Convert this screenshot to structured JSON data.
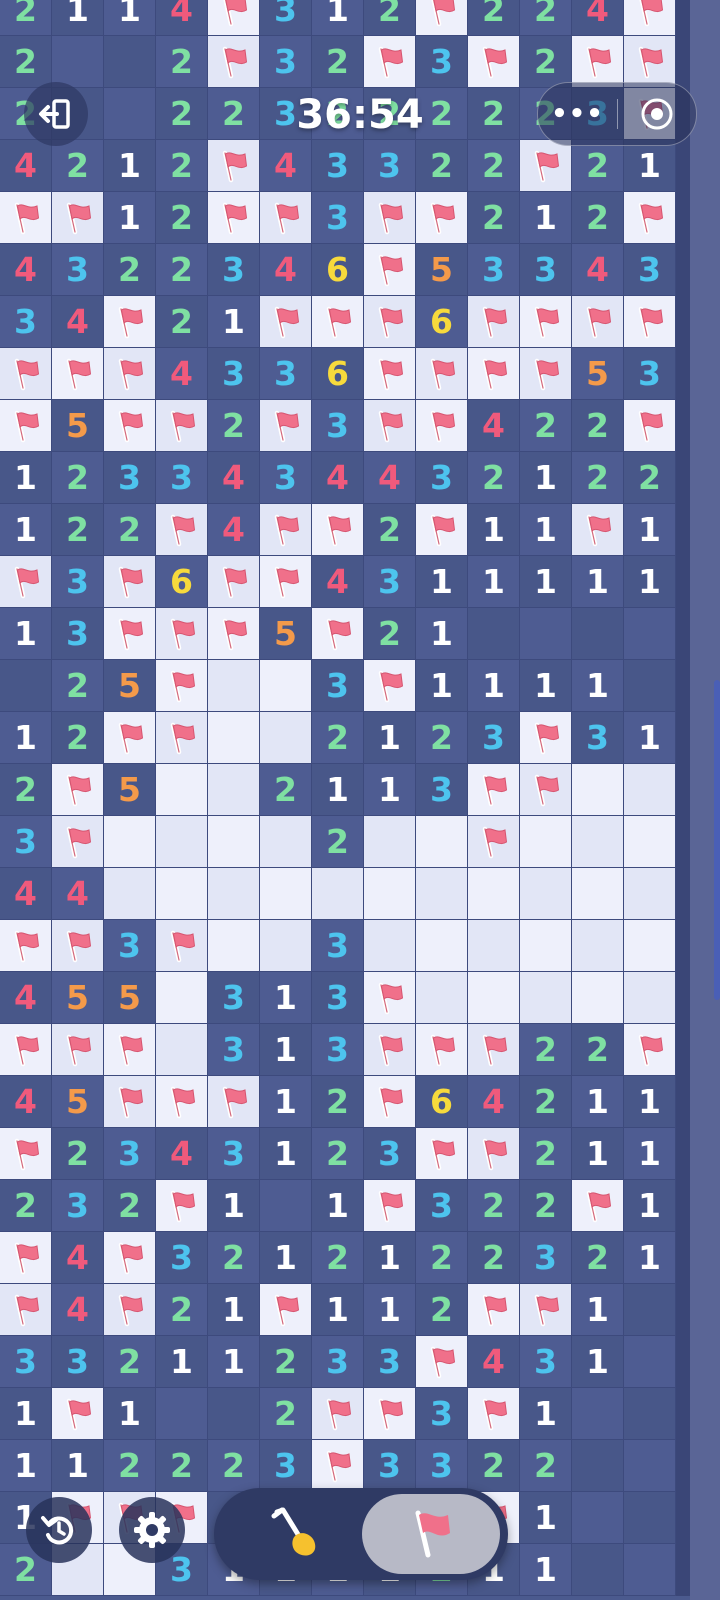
{
  "timer": "36:54",
  "colors": {
    "n1": "#ffffff",
    "n2": "#7fe0a2",
    "n3": "#4dc4ee",
    "n4": "#f05a7c",
    "n5": "#f49a4a",
    "n6": "#f7da3c",
    "flag": "#f0708a",
    "hidden": "#4e5c92",
    "open": "#eef0fb"
  },
  "legend": {
    "F": "flag (open light cell)",
    "H": "unrevealed dark cell",
    "E": "empty revealed light cell",
    "digits": "number on dark cell"
  },
  "grid": [
    [
      "2",
      "1",
      "1",
      "4",
      "F",
      "3",
      "1",
      "2",
      "F",
      "2",
      "2",
      "4",
      "F"
    ],
    [
      "2",
      "H",
      "H",
      "2",
      "F",
      "3",
      "2",
      "F",
      "3",
      "F",
      "2",
      "F",
      "F"
    ],
    [
      "2",
      "H",
      "H",
      "2",
      "2",
      "3",
      "2",
      "2",
      "2",
      "2",
      "2",
      "3",
      "F"
    ],
    [
      "4",
      "2",
      "1",
      "2",
      "F",
      "4",
      "3",
      "3",
      "2",
      "2",
      "F",
      "2",
      "1"
    ],
    [
      "F",
      "F",
      "1",
      "2",
      "F",
      "F",
      "3",
      "F",
      "F",
      "2",
      "1",
      "2",
      "F"
    ],
    [
      "4",
      "3",
      "2",
      "2",
      "3",
      "4",
      "6",
      "F",
      "5",
      "3",
      "3",
      "4",
      "3"
    ],
    [
      "3",
      "4",
      "F",
      "2",
      "1",
      "F",
      "F",
      "F",
      "6",
      "F",
      "F",
      "F",
      "F"
    ],
    [
      "F",
      "F",
      "F",
      "4",
      "3",
      "3",
      "6",
      "F",
      "F",
      "F",
      "F",
      "5",
      "3"
    ],
    [
      "F",
      "5",
      "F",
      "F",
      "2",
      "F",
      "3",
      "F",
      "F",
      "4",
      "2",
      "2",
      "F"
    ],
    [
      "1",
      "2",
      "3",
      "3",
      "4",
      "3",
      "4",
      "4",
      "3",
      "2",
      "1",
      "2",
      "2"
    ],
    [
      "1",
      "2",
      "2",
      "F",
      "4",
      "F",
      "F",
      "2",
      "F",
      "1",
      "1",
      "F",
      "1"
    ],
    [
      "F",
      "3",
      "F",
      "6",
      "F",
      "F",
      "4",
      "3",
      "1",
      "1",
      "1",
      "1",
      "1"
    ],
    [
      "1",
      "3",
      "F",
      "F",
      "F",
      "5",
      "F",
      "2",
      "1",
      "H",
      "H",
      "H",
      "H"
    ],
    [
      "H",
      "2",
      "5",
      "F",
      "E",
      "E",
      "3",
      "F",
      "1",
      "1",
      "1",
      "1",
      "H"
    ],
    [
      "1",
      "2",
      "F",
      "F",
      "E",
      "E",
      "2",
      "1",
      "2",
      "3",
      "F",
      "3",
      "1"
    ],
    [
      "2",
      "F",
      "5",
      "E",
      "E",
      "2",
      "1",
      "1",
      "3",
      "F",
      "F",
      "E",
      "E"
    ],
    [
      "3",
      "F",
      "E",
      "E",
      "E",
      "E",
      "2",
      "E",
      "E",
      "F",
      "E",
      "E",
      "E"
    ],
    [
      "4",
      "4",
      "E",
      "E",
      "E",
      "E",
      "E",
      "E",
      "E",
      "E",
      "E",
      "E",
      "E"
    ],
    [
      "F",
      "F",
      "3",
      "F",
      "E",
      "E",
      "3",
      "E",
      "E",
      "E",
      "E",
      "E",
      "E"
    ],
    [
      "4",
      "5",
      "5",
      "E",
      "3",
      "1",
      "3",
      "F",
      "E",
      "E",
      "E",
      "E",
      "E"
    ],
    [
      "F",
      "F",
      "F",
      "E",
      "3",
      "1",
      "3",
      "F",
      "F",
      "F",
      "2",
      "2",
      "F"
    ],
    [
      "4",
      "5",
      "F",
      "F",
      "F",
      "1",
      "2",
      "F",
      "6",
      "4",
      "2",
      "1",
      "1"
    ],
    [
      "F",
      "2",
      "3",
      "4",
      "3",
      "1",
      "2",
      "3",
      "F",
      "F",
      "2",
      "1",
      "1"
    ],
    [
      "2",
      "3",
      "2",
      "F",
      "1",
      "H",
      "1",
      "F",
      "3",
      "2",
      "2",
      "F",
      "1"
    ],
    [
      "F",
      "4",
      "F",
      "3",
      "2",
      "1",
      "2",
      "1",
      "2",
      "2",
      "3",
      "2",
      "1"
    ],
    [
      "F",
      "4",
      "F",
      "2",
      "1",
      "F",
      "1",
      "1",
      "2",
      "F",
      "F",
      "1",
      "H"
    ],
    [
      "3",
      "3",
      "2",
      "1",
      "1",
      "2",
      "3",
      "3",
      "F",
      "4",
      "3",
      "1",
      "H"
    ],
    [
      "1",
      "F",
      "1",
      "H",
      "H",
      "2",
      "F",
      "F",
      "3",
      "F",
      "1",
      "H",
      "H"
    ],
    [
      "1",
      "1",
      "2",
      "2",
      "2",
      "3",
      "F",
      "3",
      "3",
      "2",
      "2",
      "H",
      "H"
    ],
    [
      "1",
      "F",
      "F",
      "F",
      "H",
      "H",
      "H",
      "H",
      "H",
      "F",
      "1",
      "H",
      "H"
    ],
    [
      "2",
      "E",
      "E",
      "3",
      "1",
      "1",
      "1",
      "1",
      "2",
      "1",
      "1",
      "H",
      "H"
    ]
  ]
}
